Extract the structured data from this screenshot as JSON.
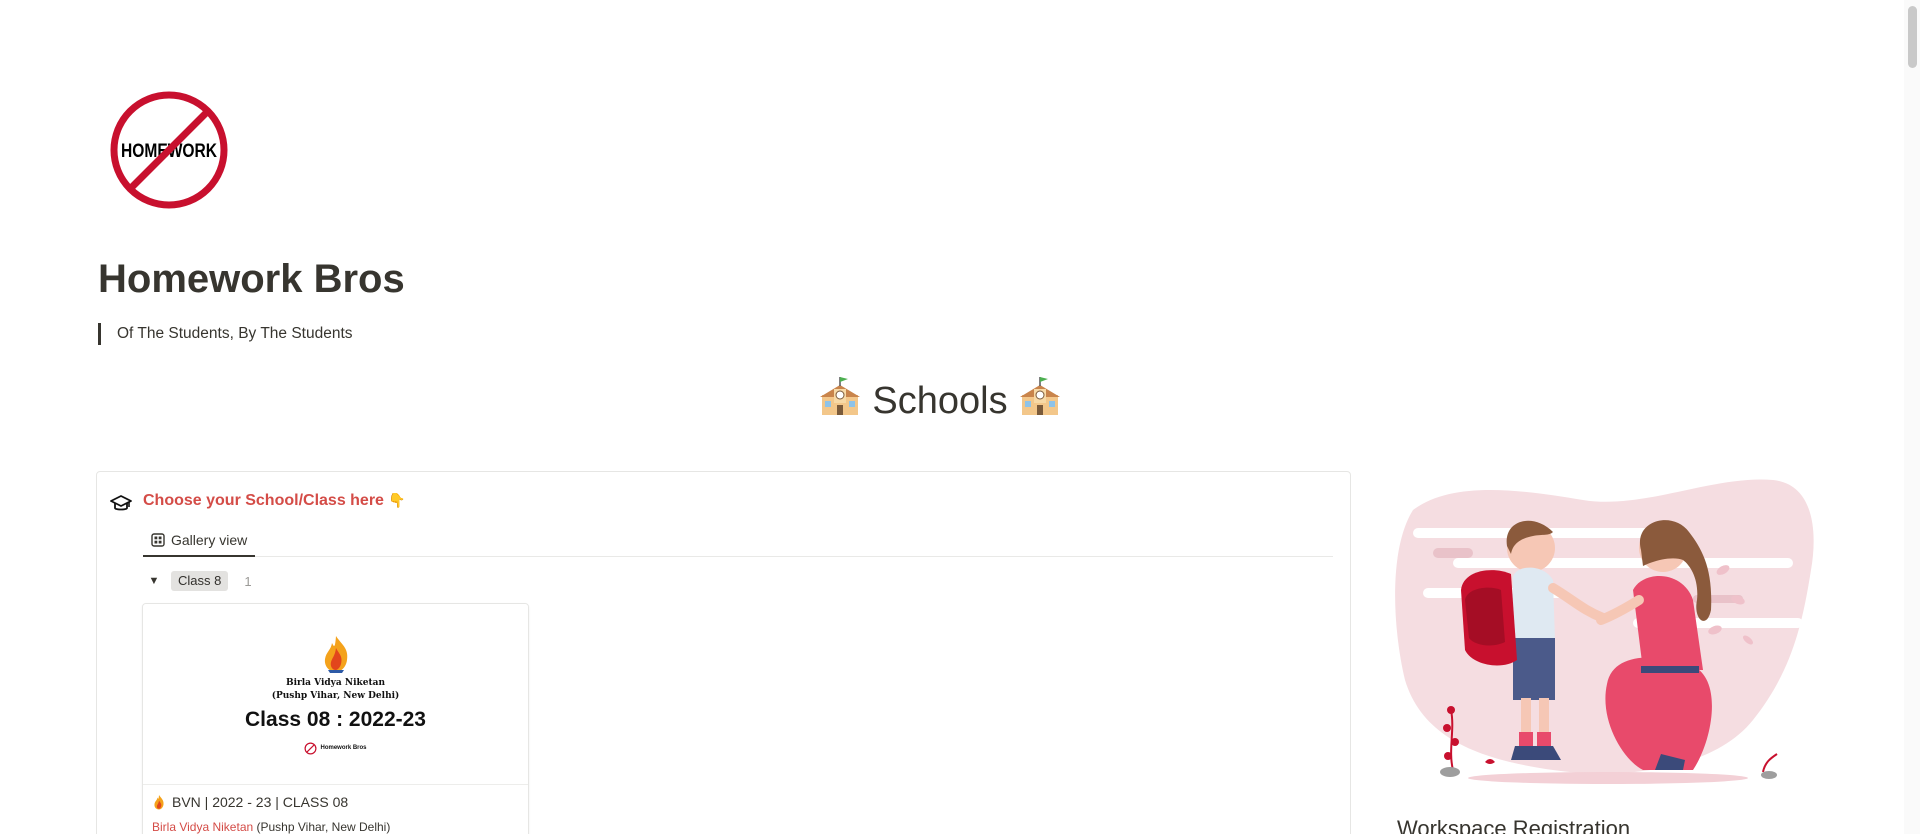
{
  "page": {
    "title": "Homework Bros",
    "quote": "Of The Students, By The Students",
    "icon": "no-homework-icon",
    "icon_text": "HOMEWORK"
  },
  "section": {
    "heading": "Schools",
    "emoji": "school-icon"
  },
  "database": {
    "icon": "graduation-cap-icon",
    "title": "Choose your School/Class here",
    "title_emoji": "👇",
    "views": [
      {
        "label": "Gallery view",
        "icon": "gallery-grid-icon",
        "active": true
      }
    ],
    "groups": [
      {
        "toggle": "▼",
        "label": "Class 8",
        "count": "1",
        "cards": [
          {
            "cover": {
              "school": "Birla Vidya Niketan",
              "location": "(Pushp Vihar, New Delhi)",
              "class_line": "Class 08 : 2022-23",
              "brand": "Homework Bros"
            },
            "title_icon": "flame-icon",
            "title": "BVN | 2022 - 23 | CLASS 08",
            "property_link": "Birla Vidya Niketan",
            "property_text": " (Pushp Vihar, New Delhi)"
          }
        ]
      }
    ]
  },
  "sidebar": {
    "heading": "Workspace Registration",
    "illustration": "mother-and-child-illustration"
  },
  "colors": {
    "title_red": "#d44c47",
    "text": "#37352f",
    "tag_bg": "#e3e2e0",
    "no_sign_red": "#c8102e",
    "illustration_pink": "#f0d4d9"
  }
}
